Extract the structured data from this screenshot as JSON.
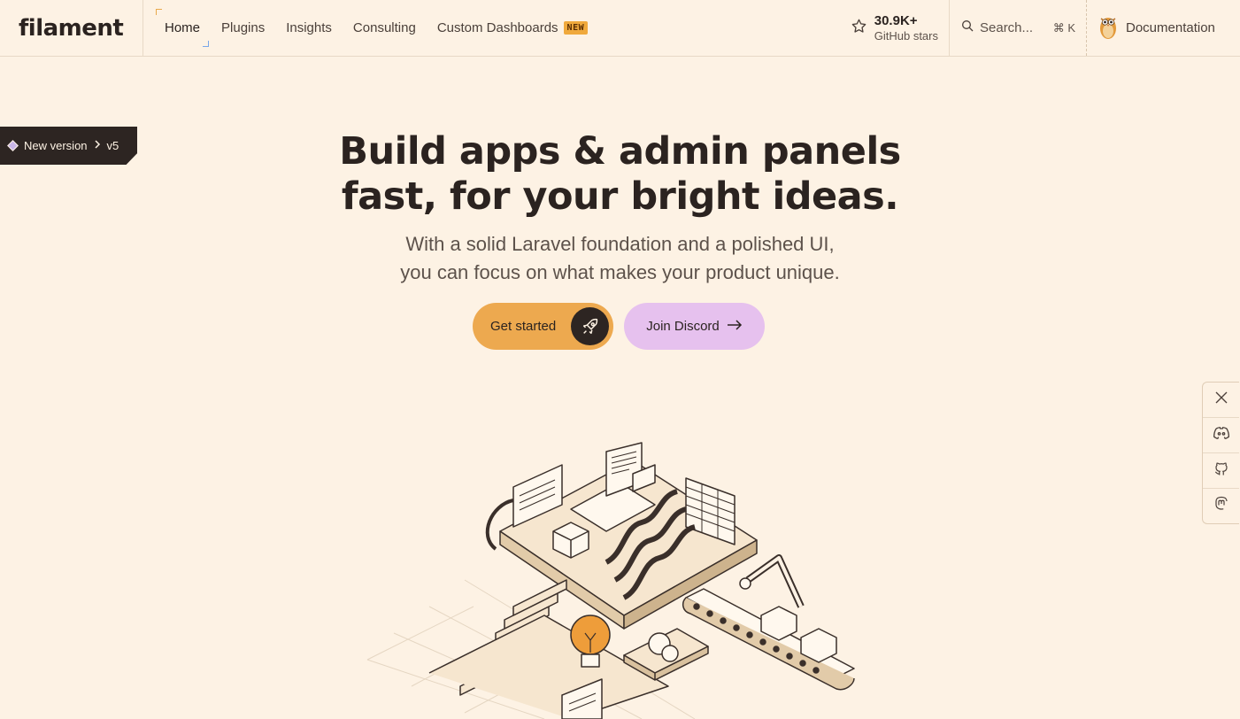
{
  "header": {
    "logo": "filament",
    "nav": [
      {
        "label": "Home"
      },
      {
        "label": "Plugins"
      },
      {
        "label": "Insights"
      },
      {
        "label": "Consulting"
      },
      {
        "label": "Custom Dashboards",
        "badge": "NEW"
      }
    ],
    "github": {
      "count": "30.9K+",
      "label": "GitHub stars"
    },
    "search": {
      "placeholder": "Search...",
      "shortcut": "⌘ K"
    },
    "docs_label": "Documentation"
  },
  "version_ribbon": {
    "label": "New version",
    "version": "v5"
  },
  "hero": {
    "title_line1": "Build apps & admin panels",
    "title_line2": "fast, for your bright ideas.",
    "subtitle_line1": "With a solid Laravel foundation and a polished UI,",
    "subtitle_line2": "you can focus on what makes your product unique.",
    "primary_cta": "Get started",
    "secondary_cta": "Join Discord"
  },
  "social": [
    {
      "icon": "x-icon"
    },
    {
      "icon": "discord-icon"
    },
    {
      "icon": "github-icon"
    },
    {
      "icon": "mastodon-icon"
    }
  ],
  "colors": {
    "background": "#fdf2e4",
    "primary_cta": "#eda94f",
    "secondary_cta": "#e6c1ee",
    "dark": "#2d2522",
    "badge": "#f0a93c"
  }
}
